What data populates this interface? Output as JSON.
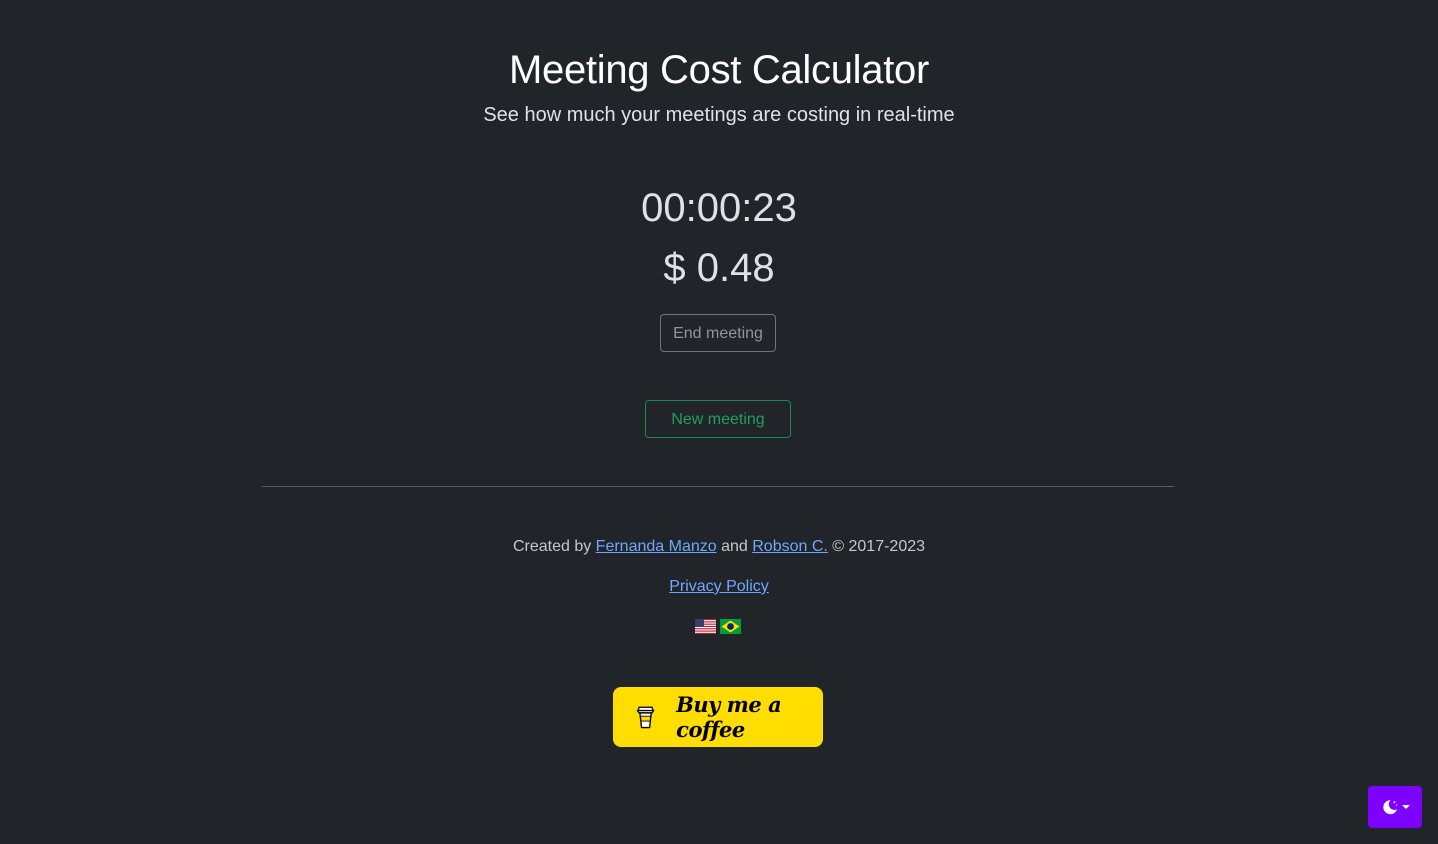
{
  "header": {
    "title": "Meeting Cost Calculator",
    "subtitle": "See how much your meetings are costing in real-time"
  },
  "meeting": {
    "elapsed_time": "00:00:23",
    "cost": "$ 0.48",
    "end_button_label": "End meeting",
    "new_button_label": "New meeting"
  },
  "footer": {
    "created_by_prefix": "Created by ",
    "author1": "Fernanda Manzo",
    "and_text": " and ",
    "author2": "Robson C.",
    "copyright": " © 2017-2023",
    "privacy_label": "Privacy Policy",
    "flags": [
      "us-flag-icon",
      "brazil-flag-icon"
    ],
    "coffee_label": "Buy me a coffee"
  },
  "theme_toggle": {
    "icon": "moon-icon",
    "color": "#7e00ff"
  },
  "colors": {
    "background": "#212529",
    "link": "#6ea8fe",
    "success": "#198754",
    "coffee": "#ffdd00"
  }
}
